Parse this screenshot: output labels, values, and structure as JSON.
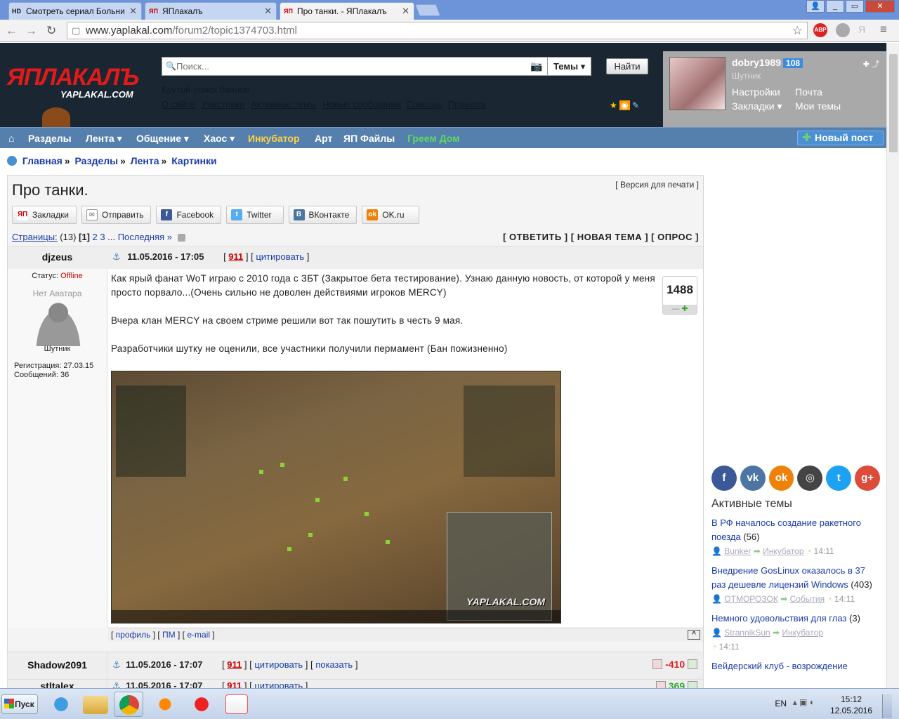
{
  "browser": {
    "tabs": [
      {
        "icon": "HD",
        "label": "Смотреть сериал Больни"
      },
      {
        "icon": "ЯП",
        "label": "ЯПлакалъ"
      },
      {
        "icon": "ЯП",
        "label": "Про танки. - ЯПлакалъ"
      }
    ],
    "url_host": "www.yaplakal.com",
    "url_path": "/forum2/topic1374703.html"
  },
  "site": {
    "logo": "ЯПЛАКАЛЪ",
    "logo_sub": "YAPLAKAL.COM",
    "search_placeholder": "Поиск...",
    "search_scope": "Темы",
    "search_button": "Найти",
    "tagline": "Крутой поиск баянов",
    "header_links": [
      "О сайте",
      "Участники",
      "Активные темы",
      "Новые сообщения",
      "Помощь",
      "Правила"
    ]
  },
  "user": {
    "name": "dobry1989",
    "count": "108",
    "role": "Шутник",
    "links": {
      "settings": "Настройки",
      "mail": "Почта",
      "bookmarks": "Закладки",
      "mytopics": "Мои темы"
    }
  },
  "nav": {
    "items": [
      "Разделы",
      "Лента",
      "Общение",
      "Хаос",
      "Инкубатор",
      "Арт",
      "ЯП Файлы",
      "Греем Дом"
    ],
    "new_post": "Новый пост"
  },
  "breadcrumbs": [
    "Главная",
    "Разделы",
    "Лента",
    "Картинки"
  ],
  "topic": {
    "title": "Про танки.",
    "print_label": "Версия для печати",
    "share": [
      "Закладки",
      "Отправить",
      "Facebook",
      "Twitter",
      "ВКонтакте",
      "OK.ru"
    ],
    "pages_label": "Страницы:",
    "pages_total": "(13)",
    "pages": [
      "[1]",
      "2",
      "3"
    ],
    "last_page": "Последняя »",
    "actions": "[ ОТВЕТИТЬ ] [ НОВАЯ ТЕМА ] [ ОПРОС ]"
  },
  "post1": {
    "author": "djzeus",
    "date": "11.05.2016 - 17:05",
    "num": "911",
    "quote": "цитировать",
    "status_label": "Статус:",
    "status": "Offline",
    "no_avatar": "Нет Аватара",
    "role": "Шутник",
    "reg": "Регистрация: 27.03.15",
    "msgs": "Сообщений: 36",
    "text": [
      "Как ярый фанат WoT играю с 2010 года с ЗБТ (Закрытое бета тестирование). Узнаю данную новость, от которой у меня просто порвало...(Очень сильно не доволен действиями игроков MERCY)",
      "Вчера клан MERCY на своем стриме решили вот так пошутить в честь 9 мая.",
      "Разработчики шутку не оценили, все участники получили пермамент (Бан пожизненно)"
    ],
    "rating": "1488",
    "watermark": "YAPLAKAL.COM",
    "footer": [
      "профиль",
      "ПМ",
      "e-mail"
    ]
  },
  "post2": {
    "author": "Shadow2091",
    "date": "11.05.2016 - 17:07",
    "num": "911",
    "quote": "цитировать",
    "show": "показать",
    "score": "-410"
  },
  "post3": {
    "author": "stltalex",
    "date": "11.05.2016 - 17:07",
    "num": "911",
    "quote": "цитировать",
    "score": "369"
  },
  "sidebar": {
    "title": "Активные темы",
    "items": [
      {
        "title": "В РФ началось создание ракетного поезда",
        "count": "(56)",
        "author": "Bunker",
        "section": "Инкубатор",
        "time": "14:11"
      },
      {
        "title": "Внедрение GosLinux оказалось в 37 раз дешевле лицензий Windows",
        "count": "(403)",
        "author": "ОТМОРОЗОК",
        "section": "События",
        "time": "14:11"
      },
      {
        "title": "Немного удовольствия для глаз",
        "count": "(3)",
        "author": "StrannikSun",
        "section": "Инкубатор",
        "time": "14:11"
      },
      {
        "title": "Вейдерский клуб - возрождение",
        "count": "",
        "author": "",
        "section": "",
        "time": ""
      }
    ]
  },
  "taskbar": {
    "start": "Пуск",
    "lang": "EN",
    "time": "15:12",
    "date": "12.05.2016"
  }
}
